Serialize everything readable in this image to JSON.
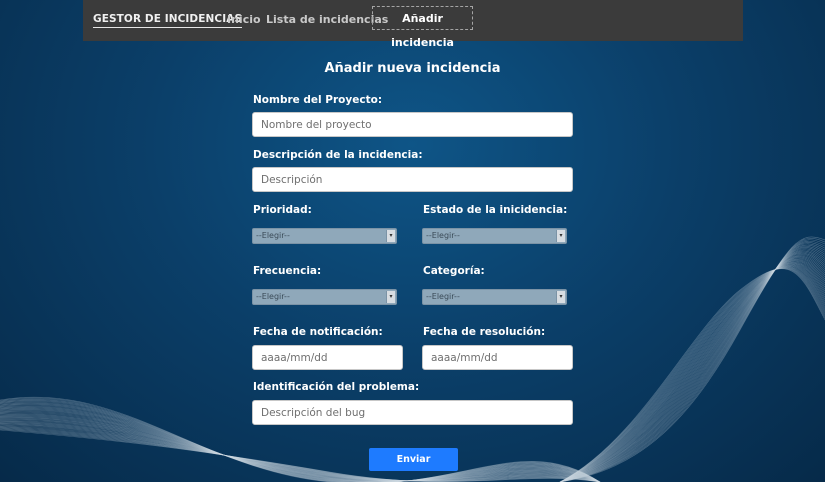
{
  "nav": {
    "brand": "GESTOR DE INCIDENCIAS",
    "links": [
      "Inicio",
      "Lista de incidencias",
      "Añadir incidencia"
    ]
  },
  "form": {
    "title": "Añadir nueva incidencia",
    "project_label": "Nombre del Proyecto:",
    "project_placeholder": "Nombre del proyecto",
    "description_label": "Descripción de la incidencia:",
    "description_placeholder": "Descripción",
    "priority_label": "Prioridad:",
    "priority_value": "--Elegir--",
    "status_label": "Estado de la inicidencia:",
    "status_value": "--Elegir--",
    "frequency_label": "Frecuencia:",
    "frequency_value": "--Elegir--",
    "category_label": "Categoría:",
    "category_value": "--Elegir--",
    "notification_date_label": "Fecha de notificación:",
    "notification_date_placeholder": "aaaa/mm/dd",
    "resolution_date_label": "Fecha de resolución:",
    "resolution_date_placeholder": "aaaa/mm/dd",
    "problem_label": "Identificación del problema:",
    "problem_placeholder": "Descripción del bug",
    "submit_label": "Enviar"
  },
  "colors": {
    "background": "#0b3f69",
    "navbar": "#3b3b3b",
    "submit": "#1e7bff"
  }
}
